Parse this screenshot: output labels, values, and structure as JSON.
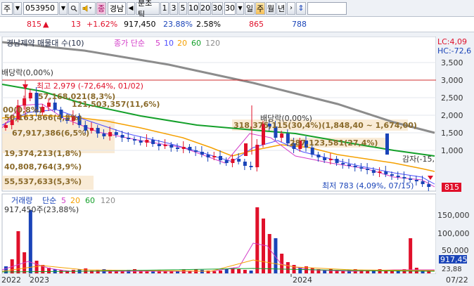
{
  "toolbar": {
    "prefix": "주",
    "code": "053950",
    "search_icon": "search-icon",
    "sound_icon": "speaker-icon",
    "name_prefix": "종",
    "name": "경남",
    "period_label": "분초틱",
    "periods": [
      "1",
      "3",
      "5",
      "10",
      "20",
      "30"
    ],
    "selected_period": "30",
    "day": "일",
    "week": "주",
    "month": "월",
    "year": "년"
  },
  "info": {
    "price": "815",
    "change": "13",
    "change_pct": "+1.62%",
    "volume": "917,450",
    "vol_ratio": "23.88%",
    "turnover": "2.58%",
    "val1": "865",
    "val2": "788"
  },
  "chart_data": {
    "type": "candlestick",
    "legend": {
      "name": "경남제약 매물대 수(10)",
      "ma_label": "종가 단순",
      "ma_periods": [
        "5",
        "10",
        "20",
        "60",
        "120"
      ],
      "lc": "LC:4,09",
      "hc": "HC:-72,6"
    },
    "y_axis": [
      "3,500",
      "3,000",
      "2,500",
      "2,000",
      "1,500",
      "1,000"
    ],
    "y_range": [
      700,
      3700
    ],
    "x_labels": [
      "2022",
      "2023",
      "2024",
      "07/22"
    ],
    "annotations": {
      "dividend1": "배당락(0,00%)",
      "high": "최고 2,979 (-72,64%, 01/02)",
      "vp1": "57,168,021(8,3%)",
      "vp2": "121,503,357(11,6%)",
      "vp3": "00(0,8%)",
      "vp4": "50,163,866(4,8%)",
      "vp5": "67,917,386(6,5%)",
      "vp6": "19,374,213(1,8%)",
      "vp7": "40,808,764(3,9%)",
      "vp8": "55,537,633(5,3%)",
      "vp9": "318,375,115(30,4%)(1,848,40 ~ 1,674,00)",
      "dividend2": "배당락(0,00%)",
      "vp10": "287,123,581(27,4%)",
      "reduction": "감자(-15,",
      "low": "최저 783 (4,09%, 07/15)",
      "price_tag": "815"
    },
    "volume": {
      "legend_name": "거래량",
      "legend_type": "단순",
      "ma_periods": [
        "5",
        "20",
        "60",
        "120"
      ],
      "current": "917,450주(23,88%)",
      "y_axis": [
        "150,000",
        "100,000",
        "50,000"
      ],
      "tag1": "917,45",
      "tag2": "23,88"
    },
    "colors": {
      "up": "#e0102a",
      "down": "#1a44b8",
      "ma5": "#d33cc8",
      "ma10": "#4d4dff",
      "ma20": "#f5a000",
      "ma60": "#14a02a",
      "ma120": "#8c8c8c",
      "high_line": "#d22c2c"
    }
  }
}
